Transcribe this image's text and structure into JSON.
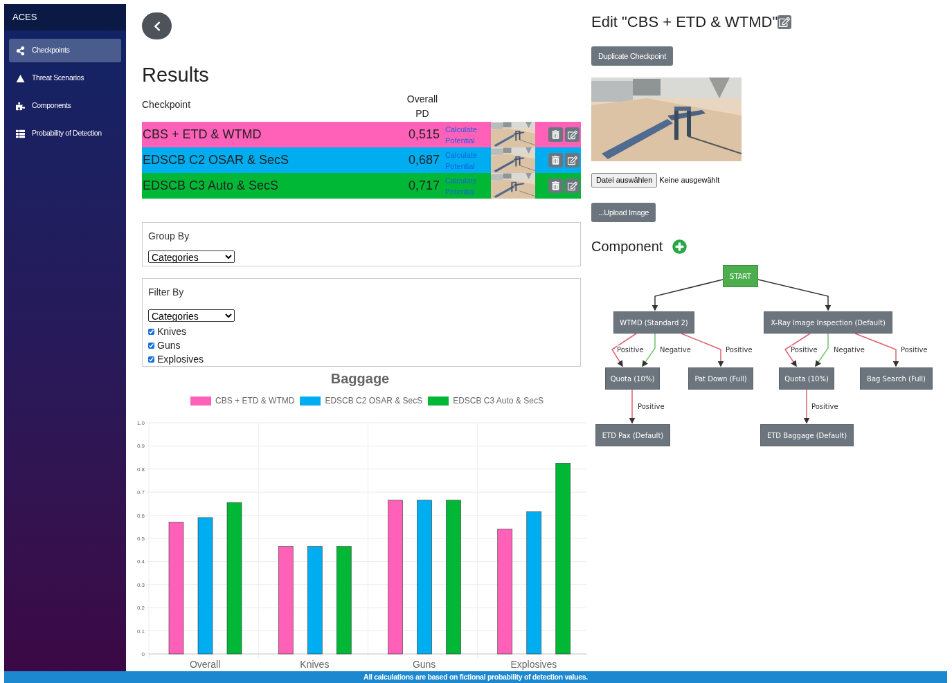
{
  "sidebar": {
    "brand": "ACES",
    "items": [
      {
        "label": "Checkpoints",
        "kind": "checkpoints",
        "selected": true
      },
      {
        "label": "Threat Scenarios",
        "kind": "threats",
        "selected": false
      },
      {
        "label": "Components",
        "kind": "components",
        "selected": false
      },
      {
        "label": "Probability of Detection",
        "kind": "detection",
        "selected": false
      }
    ]
  },
  "results": {
    "title": "Results",
    "columns": [
      "Checkpoint",
      "Overall PD"
    ],
    "rows": [
      {
        "name": "CBS + ETD & WTMD",
        "pd": "0,515",
        "link": "Calculate Potential",
        "color": "#ff61b8"
      },
      {
        "name": "EDSCB C2 OSAR & SecS",
        "pd": "0,687",
        "link": "Calculate Potential",
        "color": "#00adf0"
      },
      {
        "name": "EDSCB C3 Auto & SecS",
        "pd": "0,717",
        "link": "Calculate Potential",
        "color": "#00b836"
      }
    ]
  },
  "group_by": {
    "label": "Group By",
    "value": "Categories"
  },
  "filter_by": {
    "label": "Filter By",
    "value": "Categories",
    "options": [
      {
        "label": "Knives",
        "checked": true
      },
      {
        "label": "Guns",
        "checked": true
      },
      {
        "label": "Explosives",
        "checked": true
      }
    ]
  },
  "chart_data": {
    "type": "bar",
    "title": "Baggage",
    "categories": [
      "Overall",
      "Knives",
      "Guns",
      "Explosives"
    ],
    "series": [
      {
        "name": "CBS + ETD & WTMD",
        "color": "#ff61b8",
        "values": [
          0.57,
          0.465,
          0.665,
          0.54
        ]
      },
      {
        "name": "EDSCB C2 OSAR & SecS",
        "color": "#00adf0",
        "values": [
          0.59,
          0.465,
          0.665,
          0.615
        ]
      },
      {
        "name": "EDSCB C3 Auto & SecS",
        "color": "#00b836",
        "values": [
          0.655,
          0.465,
          0.665,
          0.825
        ]
      }
    ],
    "ylim": [
      0,
      1
    ],
    "grid": true,
    "legend": true,
    "yticks": [
      {
        "value": 0,
        "label": "0"
      },
      {
        "value": 0.1,
        "label": "0.1"
      },
      {
        "value": 0.2,
        "label": "0.2"
      },
      {
        "value": 0.3,
        "label": "0.3"
      },
      {
        "value": 0.4,
        "label": "0.4"
      },
      {
        "value": 0.5,
        "label": "0.5"
      },
      {
        "value": 0.6,
        "label": "0.6"
      },
      {
        "value": 0.7,
        "label": "0.7"
      },
      {
        "value": 0.8,
        "label": "0.8"
      },
      {
        "value": 0.9,
        "label": "0.9"
      },
      {
        "value": 1,
        "label": "1.0"
      }
    ]
  },
  "editor": {
    "title": "Edit \"CBS + ETD & WTMD\"",
    "duplicate_button": "Duplicate Checkpoint",
    "file_button": "Datei auswählen",
    "file_status": "Keine ausgewählt",
    "upload_button": "...Upload Image",
    "component_title": "Component"
  },
  "diagram": {
    "nodes": [
      {
        "label": "START",
        "kind": "start"
      },
      {
        "label": "WTMD (Standard 2)",
        "kind": "component"
      },
      {
        "label": "X-Ray Image Inspection (Default)",
        "kind": "component"
      },
      {
        "label": "Quota (10%)",
        "kind": "component"
      },
      {
        "label": "Pat Down (Full)",
        "kind": "component"
      },
      {
        "label": "Quota (10%)",
        "kind": "component"
      },
      {
        "label": "Bag Search (Full)",
        "kind": "component"
      },
      {
        "label": "ETD Pax (Default)",
        "kind": "component"
      },
      {
        "label": "ETD Baggage (Default)",
        "kind": "component"
      }
    ],
    "edges": [
      {
        "kind": "plain"
      },
      {
        "kind": "plain"
      },
      {
        "label": "Positive",
        "kind": "positive"
      },
      {
        "label": "Negative",
        "kind": "negative"
      },
      {
        "label": "Positive",
        "kind": "positive"
      },
      {
        "label": "Positive",
        "kind": "positive"
      },
      {
        "label": "Negative",
        "kind": "negative"
      },
      {
        "label": "Positive",
        "kind": "positive"
      },
      {
        "label": "Positive",
        "kind": "positive"
      },
      {
        "label": "Positive",
        "kind": "positive"
      }
    ]
  },
  "footer": "All calculations are based on fictional probability of detection values."
}
